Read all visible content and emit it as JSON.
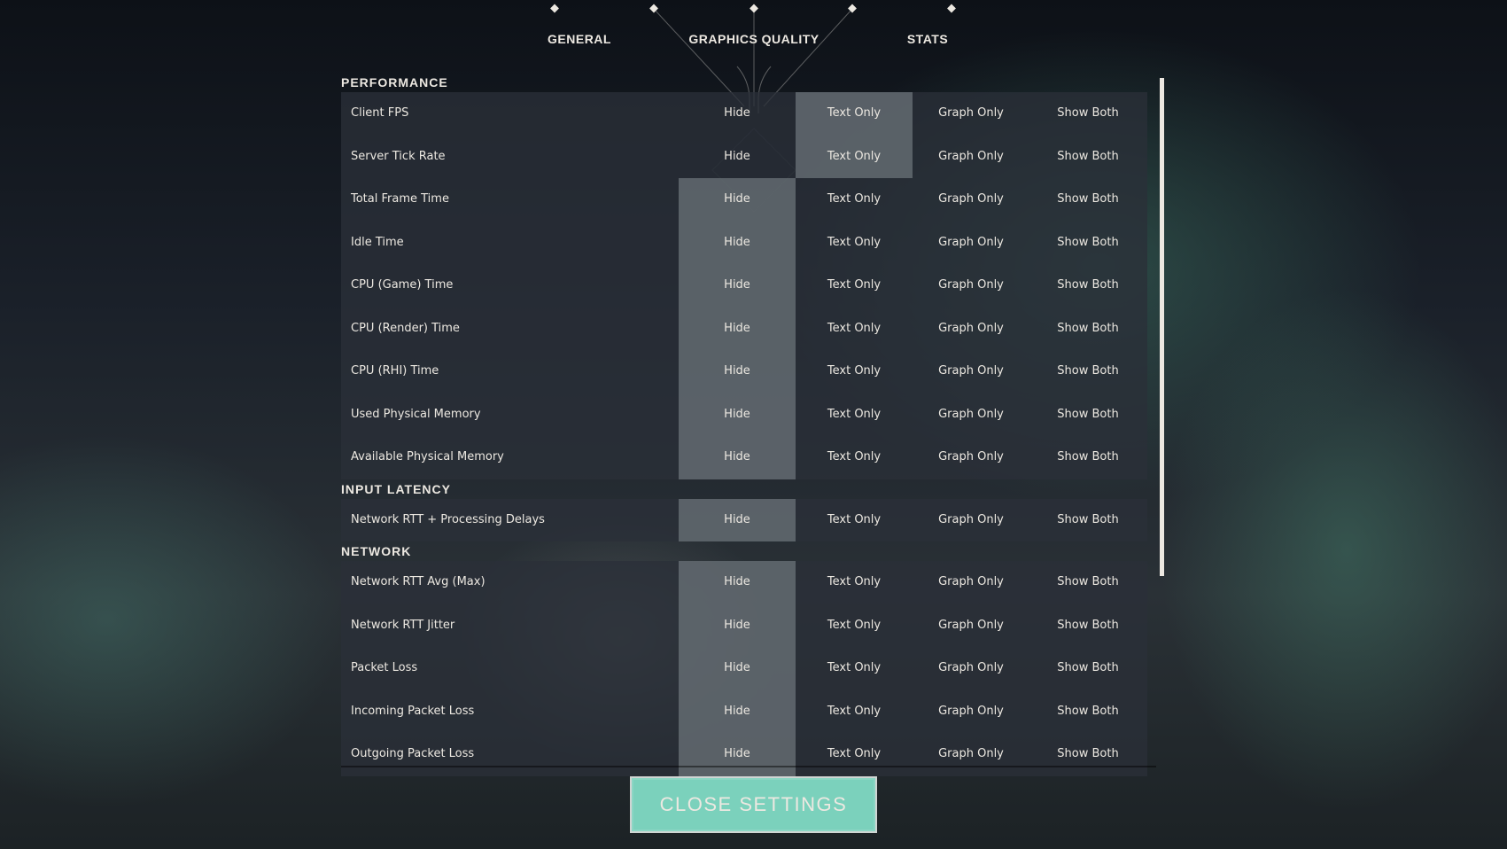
{
  "nav": {
    "tabs": [
      "GENERAL",
      "GRAPHICS QUALITY",
      "STATS"
    ],
    "active_tab": "STATS"
  },
  "options": [
    "Hide",
    "Text Only",
    "Graph Only",
    "Show Both"
  ],
  "sections": [
    {
      "title": "PERFORMANCE",
      "rows": [
        {
          "label": "Client FPS",
          "selected": "Text Only"
        },
        {
          "label": "Server Tick Rate",
          "selected": "Text Only"
        },
        {
          "label": "Total Frame Time",
          "selected": "Hide"
        },
        {
          "label": "Idle Time",
          "selected": "Hide"
        },
        {
          "label": "CPU (Game) Time",
          "selected": "Hide"
        },
        {
          "label": "CPU (Render) Time",
          "selected": "Hide"
        },
        {
          "label": "CPU (RHI) Time",
          "selected": "Hide"
        },
        {
          "label": "Used Physical Memory",
          "selected": "Hide"
        },
        {
          "label": "Available Physical Memory",
          "selected": "Hide"
        }
      ]
    },
    {
      "title": "INPUT LATENCY",
      "rows": [
        {
          "label": "Network RTT + Processing Delays",
          "selected": "Hide"
        }
      ]
    },
    {
      "title": "NETWORK",
      "rows": [
        {
          "label": "Network RTT Avg (Max)",
          "selected": "Hide"
        },
        {
          "label": "Network RTT Jitter",
          "selected": "Hide"
        },
        {
          "label": "Packet Loss",
          "selected": "Hide"
        },
        {
          "label": "Incoming Packet Loss",
          "selected": "Hide"
        },
        {
          "label": "Outgoing Packet Loss",
          "selected": "Hide"
        }
      ]
    }
  ],
  "footer": {
    "close_label": "CLOSE SETTINGS"
  },
  "colors": {
    "accent": "#7bd1bc",
    "text": "#ece8e1",
    "selected_bg": "#6e767c"
  }
}
